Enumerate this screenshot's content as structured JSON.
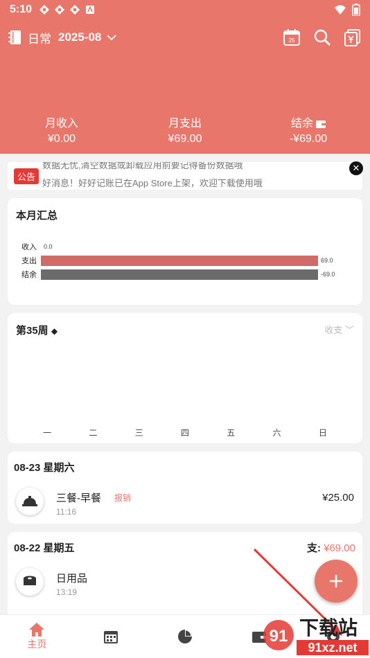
{
  "status_bar": {
    "time": "5:10"
  },
  "header": {
    "book_name": "日常",
    "period": "2025-08",
    "calendar_day": "25",
    "summary": {
      "income": {
        "label": "月收入",
        "value": "¥0.00"
      },
      "expense": {
        "label": "月支出",
        "value": "¥69.00"
      },
      "balance": {
        "label": "结余",
        "value": "-¥69.00"
      }
    }
  },
  "notice": {
    "badge": "公告",
    "line1": "数据无忧,清空数据或卸载应用前要记得备份数据哦",
    "line2": "好消息！好好记账已在App Store上架，欢迎下载使用哦"
  },
  "monthly_summary": {
    "title": "本月汇总",
    "chart_data": {
      "type": "bar",
      "orientation": "horizontal",
      "categories": [
        "收入",
        "支出",
        "结余"
      ],
      "values": [
        0.0,
        69.0,
        -69.0
      ],
      "value_labels": [
        "0.0",
        "69.0",
        "-69.0"
      ],
      "colors": [
        "#e9766a",
        "#cf6a66",
        "#6b6b6b"
      ]
    }
  },
  "weekly": {
    "title": "第35周",
    "filter": "收支",
    "chart_data": {
      "type": "bar",
      "categories": [
        "一",
        "二",
        "三",
        "四",
        "五",
        "六",
        "日"
      ],
      "values": []
    }
  },
  "days": [
    {
      "date": "08-23 星期六",
      "total_label": "",
      "total_amount": "",
      "entries": [
        {
          "name": "三餐-早餐",
          "tag": "报销",
          "time": "11:16",
          "amount": "¥25.00",
          "icon": "meal-icon"
        }
      ]
    },
    {
      "date": "08-22 星期五",
      "total_label": "支:",
      "total_amount": "¥69.00",
      "entries": [
        {
          "name": "日用品",
          "tag": "",
          "time": "13:19",
          "amount": "",
          "icon": "tissue-icon"
        }
      ]
    }
  ],
  "tabs": [
    {
      "label": "主页",
      "icon": "home-icon",
      "active": true
    },
    {
      "label": "",
      "icon": "calendar-icon",
      "active": false
    },
    {
      "label": "",
      "icon": "pie-chart-icon",
      "active": false
    },
    {
      "label": "",
      "icon": "wallet-icon",
      "active": false
    },
    {
      "label": "",
      "icon": "settings-icon",
      "active": false
    }
  ],
  "watermark": {
    "brand": "下载站",
    "domain": "91xz.net"
  },
  "colors": {
    "accent": "#e9766a",
    "income_bar": "#e9766a",
    "expense_bar": "#cf6a66",
    "balance_bar": "#6b6b6b"
  }
}
